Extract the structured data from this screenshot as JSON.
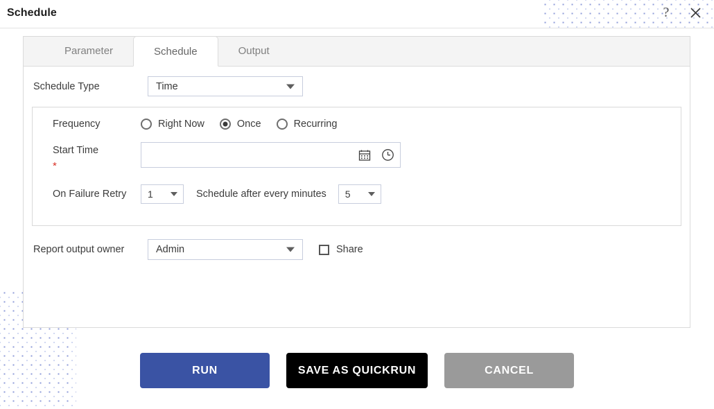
{
  "window": {
    "title": "Schedule",
    "help_icon": "question-mark-icon",
    "close_icon": "close-icon"
  },
  "tabs": [
    {
      "label": "Parameter",
      "active": false
    },
    {
      "label": "Schedule",
      "active": true
    },
    {
      "label": "Output",
      "active": false
    }
  ],
  "form": {
    "schedule_type": {
      "label": "Schedule Type",
      "value": "Time",
      "caret_icon": "chevron-down-icon"
    },
    "frequency": {
      "label": "Frequency",
      "options": [
        {
          "label": "Right Now",
          "selected": false
        },
        {
          "label": "Once",
          "selected": true
        },
        {
          "label": "Recurring",
          "selected": false
        }
      ]
    },
    "start_time": {
      "label": "Start Time",
      "required_marker": "*",
      "value": "",
      "placeholder": "",
      "calendar_icon": "calendar-icon",
      "clock_icon": "clock-icon"
    },
    "on_failure_retry": {
      "label": "On Failure Retry",
      "value": "1"
    },
    "schedule_after": {
      "label": "Schedule after every minutes",
      "value": "5"
    },
    "report_output_owner": {
      "label": "Report output owner",
      "value": "Admin"
    },
    "share": {
      "label": "Share",
      "checked": false
    }
  },
  "footer": {
    "run_label": "RUN",
    "save_label": "SAVE AS QUICKRUN",
    "cancel_label": "CANCEL"
  },
  "colors": {
    "run_button": "#3a53a4",
    "save_button": "#000000",
    "cancel_button": "#9a9a9a",
    "required_star": "#d93025",
    "dot_pattern": "#8e9bd8"
  }
}
